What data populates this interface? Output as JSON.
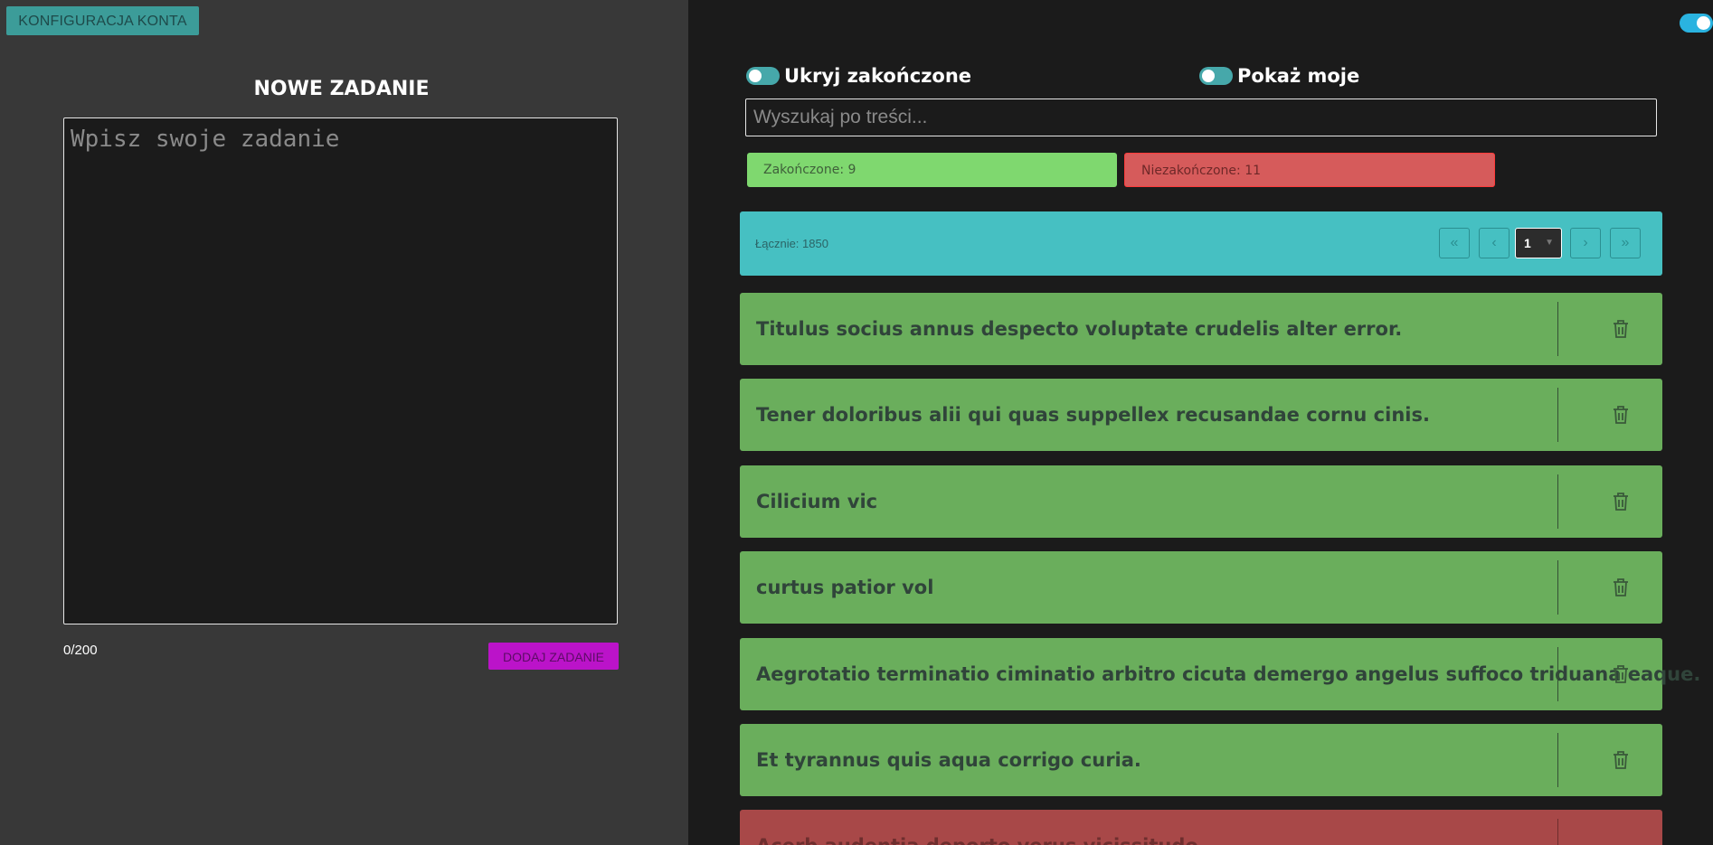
{
  "left_panel": {
    "account_button": "KONFIGURACJA KONTA",
    "new_task_title": "NOWE ZADANIE",
    "task_placeholder": "Wpisz swoje zadanie",
    "counter": "0/200",
    "add_button": "DODAJ ZADANIE"
  },
  "filters": {
    "hide_completed": "Ukryj zakończone",
    "show_mine": "Pokaż moje",
    "search_placeholder": "Wyszukaj po treści..."
  },
  "badges": {
    "completed": "Zakończone: 9",
    "uncompleted": "Niezakończone: 11"
  },
  "pager": {
    "total": "Łącznie: 1850",
    "first": "«",
    "prev": "‹",
    "page": "1",
    "next": "›",
    "last": "»"
  },
  "tasks": [
    {
      "text": "Titulus socius annus despecto voluptate crudelis alter error.",
      "status": "completed"
    },
    {
      "text": "Tener doloribus alii qui quas suppellex recusandae cornu cinis.",
      "status": "completed"
    },
    {
      "text": "Cilicium vic",
      "status": "completed"
    },
    {
      "text": "curtus patior vol",
      "status": "completed"
    },
    {
      "text": "Aegrotatio terminatio ciminatio arbitro cicuta demergo angelus suffoco triduana eaque.",
      "status": "completed"
    },
    {
      "text": "Et tyrannus quis aqua corrigo curia.",
      "status": "completed"
    },
    {
      "text": "Acerb audentia deporto verus vicissitudo",
      "status": "uncompleted"
    }
  ],
  "colors": {
    "left_bg": "#383838",
    "right_bg": "#1b1b1b",
    "accent_teal": "#46c0c2",
    "completed_green": "#6aae5c",
    "uncompleted_red": "#a84848",
    "add_button_purple": "#bb13c9"
  },
  "icons": {
    "delete": "trash-icon",
    "first_page": "double-chevron-left-icon",
    "prev_page": "chevron-left-icon",
    "next_page": "chevron-right-icon",
    "last_page": "double-chevron-right-icon"
  }
}
